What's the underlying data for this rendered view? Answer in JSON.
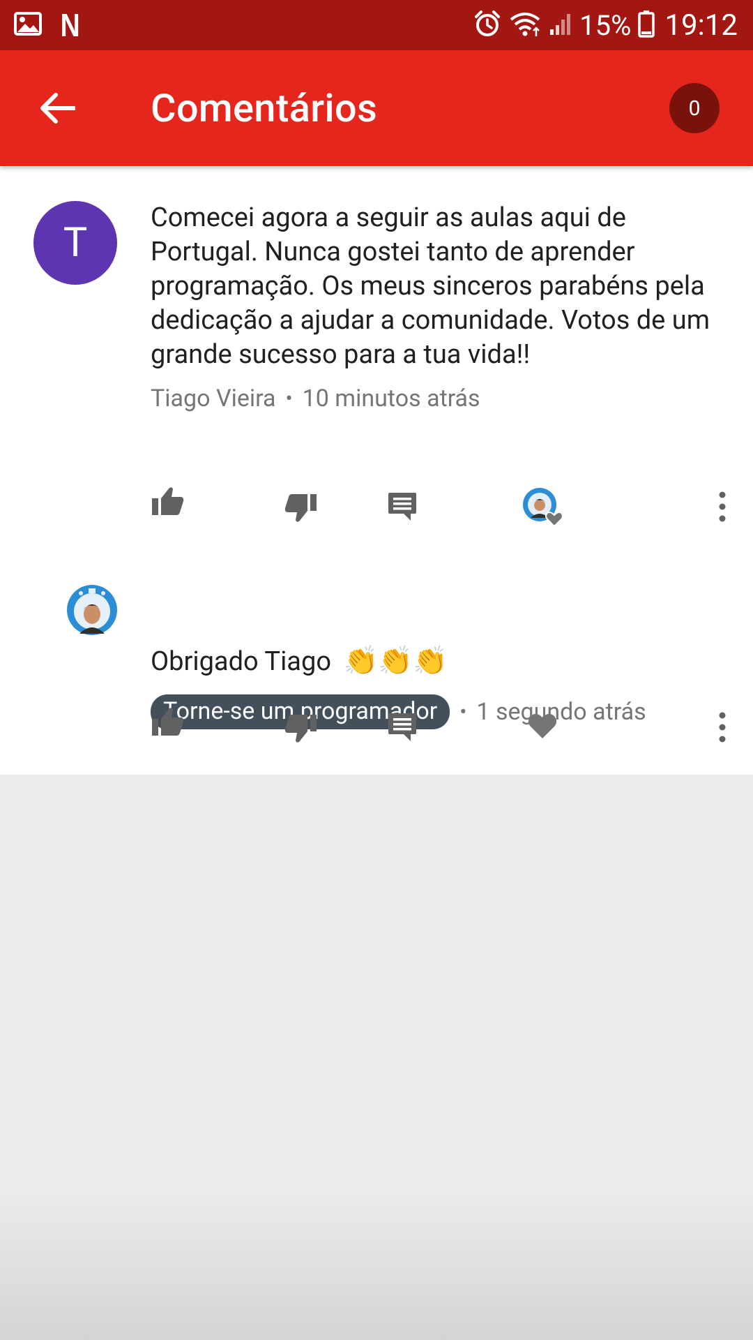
{
  "status_bar": {
    "battery_percent": "15%",
    "time": "19:12",
    "left_icons": [
      "image-icon",
      "netflix-icon"
    ],
    "right_icons": [
      "alarm-icon",
      "wifi-icon",
      "signal-icon",
      "battery-icon"
    ]
  },
  "app_bar": {
    "title": "Comentários",
    "comment_count": "0",
    "color": "#e5261c"
  },
  "comments": [
    {
      "avatar_letter": "T",
      "avatar_color": "#5e35b1",
      "text": "Comecei agora a seguir as aulas aqui de Portugal. Nunca gostei tanto de aprender programação. Os meus sinceros parabéns pela dedicação a ajudar a comunidade. Votos de um grande sucesso para a tua vida!!",
      "author": "Tiago Vieira",
      "time": "10 minutos atrás"
    },
    {
      "text": "Obrigado Tiago",
      "emoji": "👏👏👏",
      "author_badge": "Torne-se um programador",
      "time": "1 segundo atrás"
    }
  ]
}
